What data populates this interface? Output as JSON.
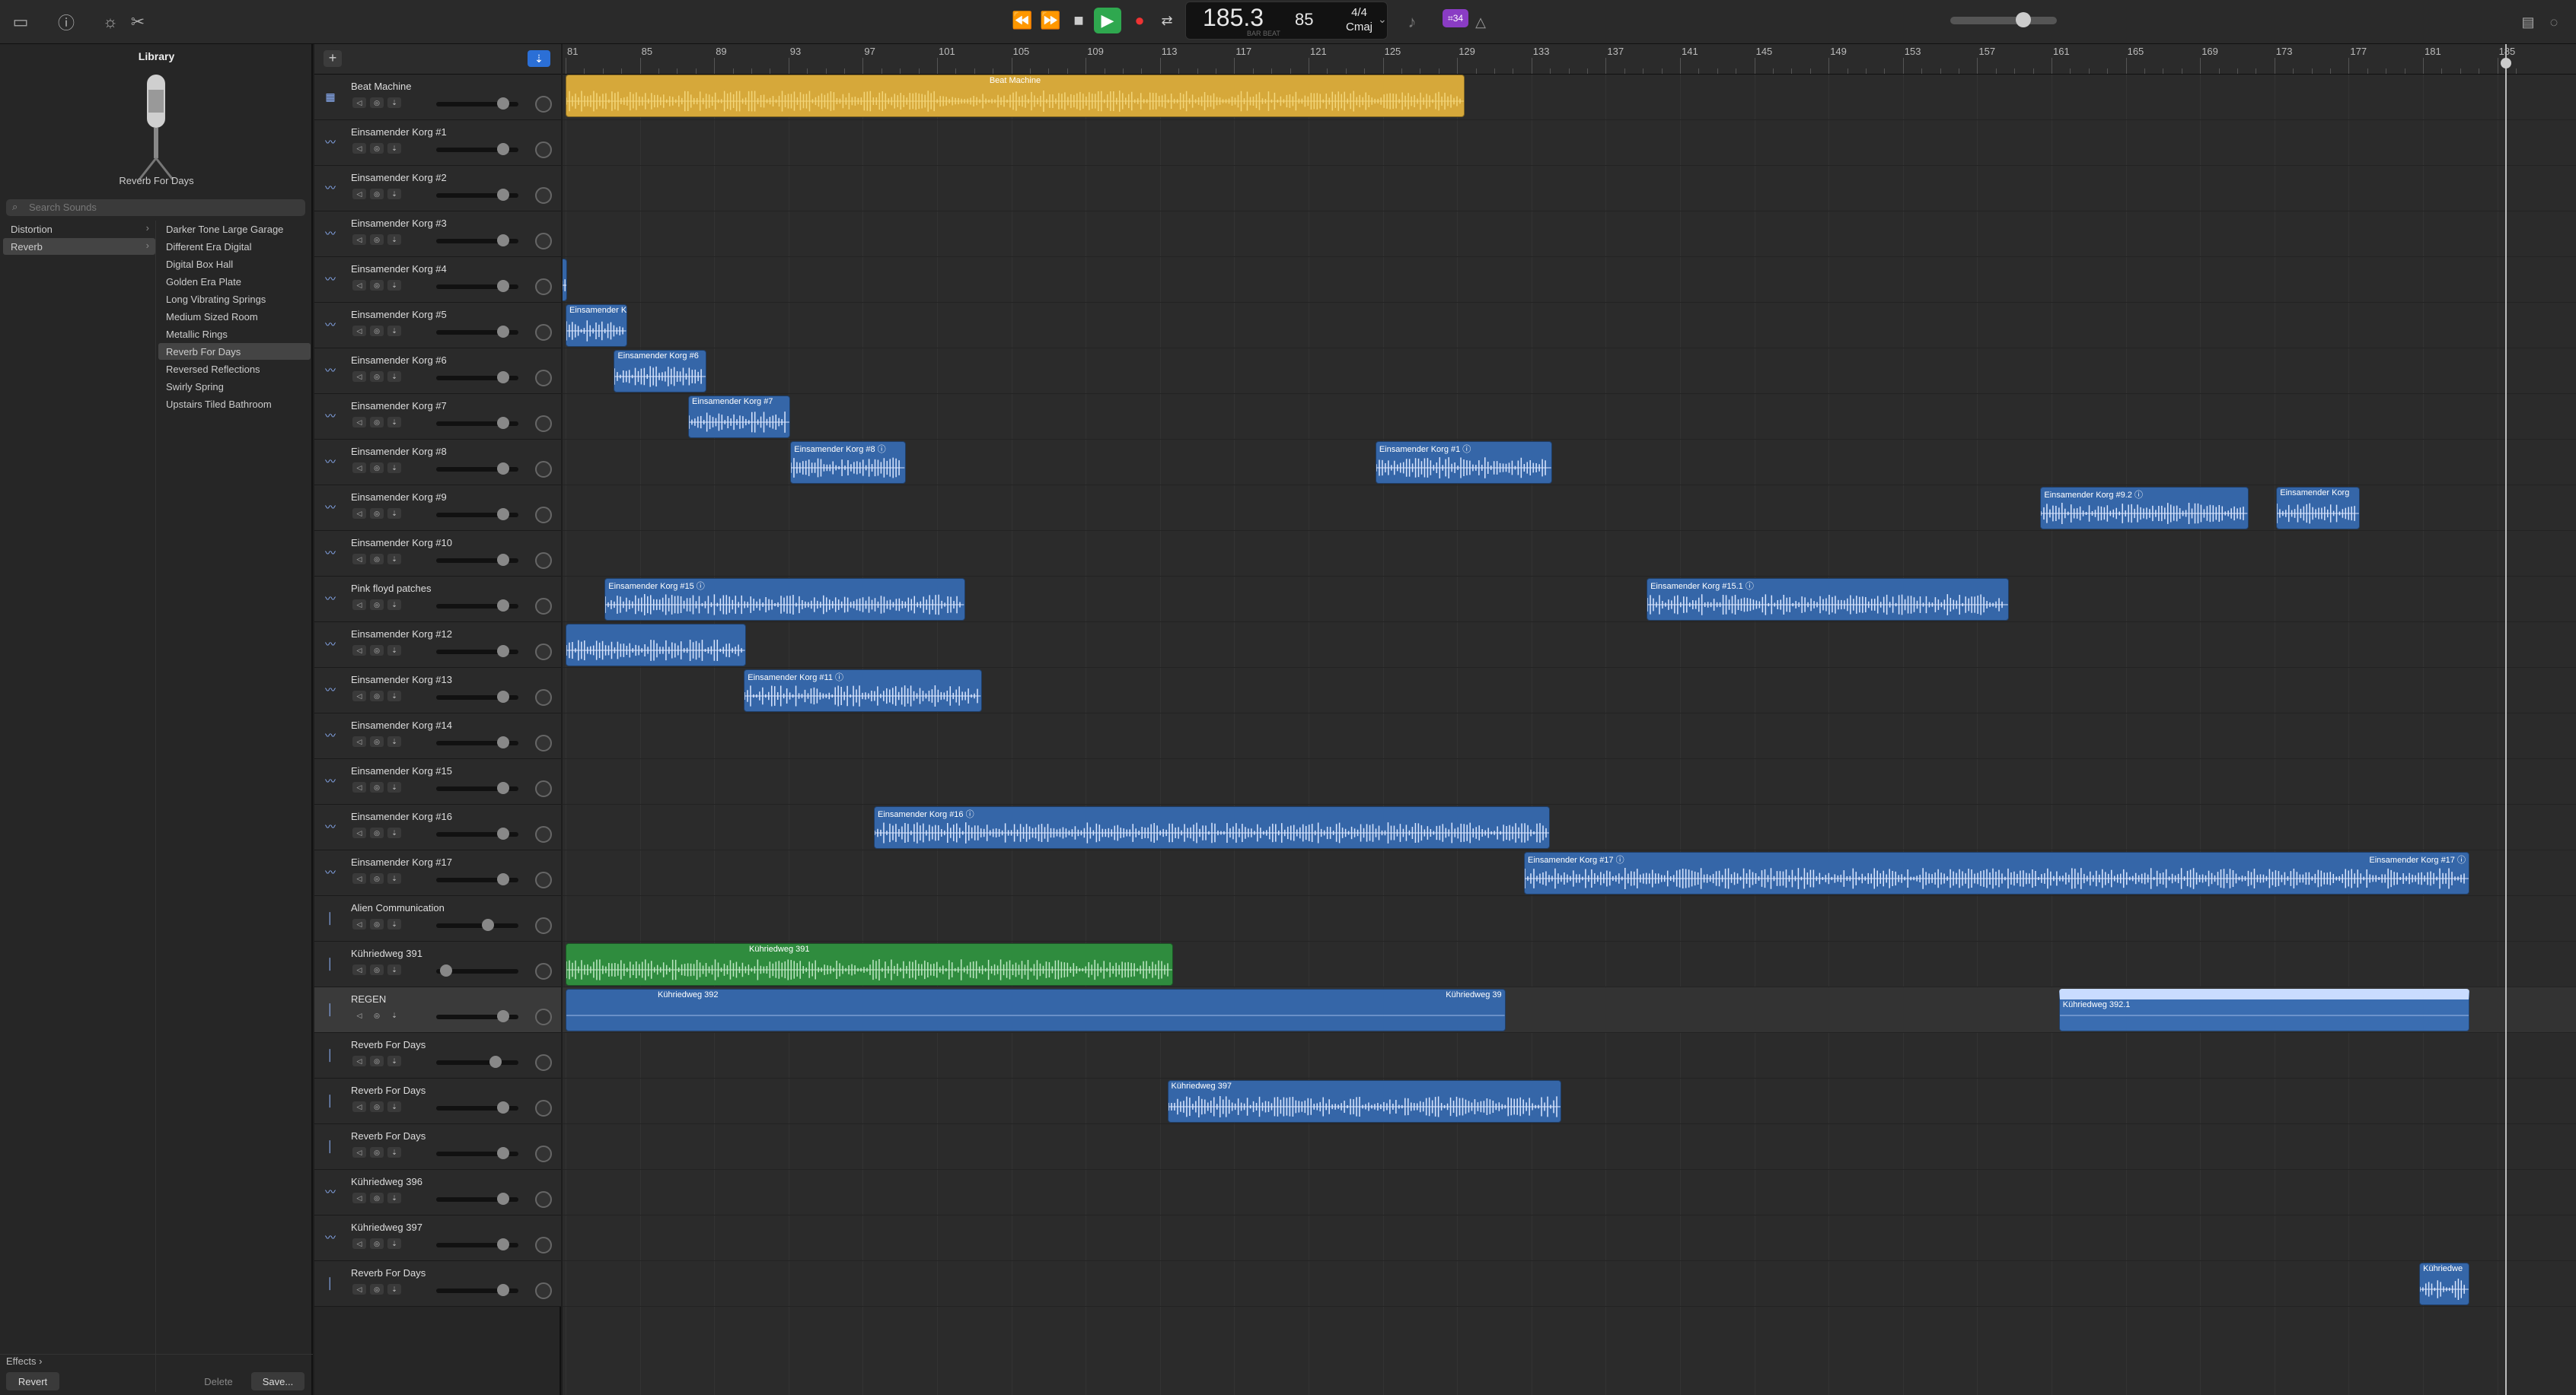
{
  "toolbar": {
    "lcd_tempo": "185.3",
    "lcd_tempo_sub": "BAR   BEAT",
    "lcd_bar": "85",
    "lcd_sig_top": "4/4",
    "lcd_sig_bottom": "Cmaj",
    "badge": "⌗34",
    "play_color": "#2fa84f",
    "record_color": "#e33333"
  },
  "library": {
    "title": "Library",
    "preset_name": "Reverb For Days",
    "search_placeholder": "Search Sounds",
    "categories": [
      {
        "label": "Distortion",
        "selected": false
      },
      {
        "label": "Reverb",
        "selected": true
      }
    ],
    "presets": [
      {
        "label": "Darker Tone Large Garage"
      },
      {
        "label": "Different Era Digital"
      },
      {
        "label": "Digital Box Hall"
      },
      {
        "label": "Golden Era Plate"
      },
      {
        "label": "Long Vibrating Springs"
      },
      {
        "label": "Medium Sized Room"
      },
      {
        "label": "Metallic Rings"
      },
      {
        "label": "Reverb For Days",
        "selected": true
      },
      {
        "label": "Reversed Reflections"
      },
      {
        "label": "Swirly Spring"
      },
      {
        "label": "Upstairs Tiled Bathroom"
      }
    ],
    "effects_label": "Effects",
    "revert_label": "Revert",
    "delete_label": "Delete",
    "save_label": "Save..."
  },
  "tracks": [
    {
      "name": "Beat Machine",
      "type": "drum",
      "fader": 0.8
    },
    {
      "name": "Einsamender Korg #1",
      "type": "audio",
      "fader": 0.8
    },
    {
      "name": "Einsamender Korg #2",
      "type": "audio",
      "fader": 0.8
    },
    {
      "name": "Einsamender Korg #3",
      "type": "audio",
      "fader": 0.8
    },
    {
      "name": "Einsamender Korg #4",
      "type": "audio",
      "fader": 0.8
    },
    {
      "name": "Einsamender Korg #5",
      "type": "audio",
      "fader": 0.8
    },
    {
      "name": "Einsamender Korg #6",
      "type": "audio",
      "fader": 0.8
    },
    {
      "name": "Einsamender Korg #7",
      "type": "audio",
      "fader": 0.8
    },
    {
      "name": "Einsamender Korg #8",
      "type": "audio",
      "fader": 0.8
    },
    {
      "name": "Einsamender Korg #9",
      "type": "audio",
      "fader": 0.8
    },
    {
      "name": "Einsamender Korg #10",
      "type": "audio",
      "fader": 0.8
    },
    {
      "name": "Pink floyd patches",
      "type": "audio",
      "fader": 0.8
    },
    {
      "name": "Einsamender Korg #12",
      "type": "audio",
      "fader": 0.8
    },
    {
      "name": "Einsamender Korg #13",
      "type": "audio",
      "fader": 0.8
    },
    {
      "name": "Einsamender Korg #14",
      "type": "audio",
      "fader": 0.8
    },
    {
      "name": "Einsamender Korg #15",
      "type": "audio",
      "fader": 0.8
    },
    {
      "name": "Einsamender Korg #16",
      "type": "audio",
      "fader": 0.8
    },
    {
      "name": "Einsamender Korg #17",
      "type": "audio",
      "fader": 0.8
    },
    {
      "name": "Alien Communication",
      "type": "mic",
      "fader": 0.6
    },
    {
      "name": "Kühriedweg 391",
      "type": "mic",
      "fader": 0.05
    },
    {
      "name": "REGEN",
      "type": "mic",
      "fader": 0.8,
      "selected": true
    },
    {
      "name": "Reverb For Days",
      "type": "mic",
      "fader": 0.7
    },
    {
      "name": "Reverb For Days",
      "type": "mic",
      "fader": 0.8
    },
    {
      "name": "Reverb For Days",
      "type": "mic",
      "fader": 0.8
    },
    {
      "name": "Kühriedweg 396",
      "type": "audio",
      "fader": 0.8
    },
    {
      "name": "Kühriedweg 397",
      "type": "audio",
      "fader": 0.8
    },
    {
      "name": "Reverb For Days",
      "type": "mic",
      "fader": 0.8
    }
  ],
  "ruler": {
    "bars": [
      "81",
      "85",
      "89",
      "93",
      "97",
      "101",
      "105",
      "109",
      "113",
      "117",
      "121",
      "125",
      "129",
      "133",
      "137",
      "141",
      "145",
      "149",
      "153",
      "157",
      "161",
      "165",
      "169",
      "173",
      "177",
      "181",
      "185"
    ]
  },
  "regions": [
    {
      "track": 0,
      "start": 81,
      "end": 129.4,
      "label": "Beat Machine",
      "color": "yellow",
      "centered": true
    },
    {
      "track": 4,
      "start": 80.2,
      "end": 81.1,
      "label": "",
      "color": "blue"
    },
    {
      "track": 5,
      "start": 81,
      "end": 84.3,
      "label": "Einsamender Korg",
      "color": "blue"
    },
    {
      "track": 6,
      "start": 83.6,
      "end": 88.6,
      "label": "Einsamender Korg #6",
      "color": "blue"
    },
    {
      "track": 7,
      "start": 87.6,
      "end": 93.1,
      "label": "Einsamender Korg #7",
      "color": "blue"
    },
    {
      "track": 8,
      "start": 93.1,
      "end": 99.3,
      "label": "Einsamender Korg #8 ⓘ",
      "color": "blue"
    },
    {
      "track": 8,
      "start": 124.6,
      "end": 134.1,
      "label": "Einsamender Korg #1 ⓘ",
      "color": "blue"
    },
    {
      "track": 9,
      "start": 160.4,
      "end": 171.6,
      "label": "Einsamender Korg #9.2 ⓘ",
      "color": "blue"
    },
    {
      "track": 9,
      "start": 173.1,
      "end": 177.6,
      "label": "Einsamender Korg",
      "color": "blue"
    },
    {
      "track": 11,
      "start": 83.1,
      "end": 102.5,
      "label": "Einsamender Korg #15 ⓘ",
      "color": "blue"
    },
    {
      "track": 11,
      "start": 139.2,
      "end": 158.7,
      "label": "Einsamender Korg #15.1 ⓘ",
      "color": "blue"
    },
    {
      "track": 12,
      "start": 81,
      "end": 90.7,
      "label": "",
      "color": "blue"
    },
    {
      "track": 13,
      "start": 90.6,
      "end": 103.4,
      "label": "Einsamender Korg #11 ⓘ",
      "color": "blue"
    },
    {
      "track": 16,
      "start": 97.6,
      "end": 134,
      "label": "Einsamender Korg #16 ⓘ",
      "color": "blue"
    },
    {
      "track": 17,
      "start": 132.6,
      "end": 183.5,
      "label": "Einsamender Korg #17 ⓘ",
      "color": "blue",
      "label2": "Einsamender Korg #17 ⓘ"
    },
    {
      "track": 19,
      "start": 81,
      "end": 113.7,
      "label": "Kühriedweg 391",
      "color": "green",
      "label_offset": 10
    },
    {
      "track": 20,
      "start": 81,
      "end": 131.6,
      "label": "Kühriedweg 392",
      "color": "lightblue",
      "label_offset": 5,
      "label2": "Kühriedweg 39",
      "flat": true
    },
    {
      "track": 20,
      "start": 161.4,
      "end": 183.5,
      "label": "Kühriedweg 392.1",
      "color": "lightblue",
      "flat": true
    },
    {
      "track": 22,
      "start": 113.4,
      "end": 134.6,
      "label": "Kühriedweg 397",
      "color": "blue"
    },
    {
      "track": 26,
      "start": 180.8,
      "end": 183.5,
      "label": "Kühriedwe",
      "color": "blue"
    }
  ]
}
